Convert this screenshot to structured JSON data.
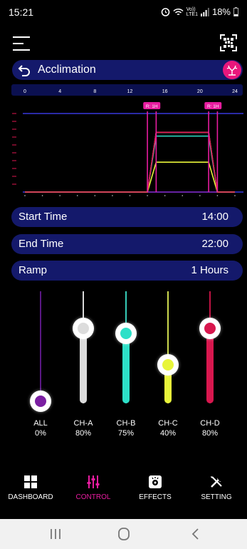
{
  "status": {
    "time": "15:21",
    "network_top": "Vo))",
    "network_bottom": "LTE1",
    "battery": "18%"
  },
  "header": {
    "title": "Acclimation"
  },
  "timeline": {
    "hours": [
      "0",
      "4",
      "8",
      "12",
      "16",
      "20",
      "24"
    ],
    "ramp_markers": [
      "R: 1H",
      "R: 1H"
    ]
  },
  "chart_data": {
    "type": "line",
    "xlim": [
      0,
      24
    ],
    "start_hour": 14,
    "end_hour": 22,
    "ramp_hours": 1,
    "series": [
      {
        "name": "ALL",
        "value": 0,
        "color": "#7b1fa2"
      },
      {
        "name": "CH-A",
        "value": 80,
        "color": "#e0e0e0"
      },
      {
        "name": "CH-B",
        "value": 75,
        "color": "#2de0c8"
      },
      {
        "name": "CH-C",
        "value": 40,
        "color": "#e8f53a"
      },
      {
        "name": "CH-D",
        "value": 80,
        "color": "#e0164f"
      }
    ]
  },
  "rows": [
    {
      "label": "Start Time",
      "value": "14:00"
    },
    {
      "label": "End Time",
      "value": "22:00"
    },
    {
      "label": "Ramp",
      "value": "1 Hours"
    }
  ],
  "channels": [
    {
      "name": "ALL",
      "percent": "0%",
      "level": 0,
      "color": "#7b1fa2",
      "track": "#6a1b9a"
    },
    {
      "name": "CH-A",
      "percent": "80%",
      "level": 80,
      "color": "#dcdcdc",
      "track": "#ffffff"
    },
    {
      "name": "CH-B",
      "percent": "75%",
      "level": 75,
      "color": "#2de0c8",
      "track": "#3ff0d8"
    },
    {
      "name": "CH-C",
      "percent": "40%",
      "level": 40,
      "color": "#e8f53a",
      "track": "#f0ff5c"
    },
    {
      "name": "CH-D",
      "percent": "80%",
      "level": 80,
      "color": "#d8174e",
      "track": "#e0164f"
    }
  ],
  "nav": [
    {
      "label": "DASHBOARD",
      "icon": "grid-icon",
      "active": false
    },
    {
      "label": "CONTROL",
      "icon": "sliders-icon",
      "active": true
    },
    {
      "label": "EFFECTS",
      "icon": "effects-icon",
      "active": false
    },
    {
      "label": "SETTING",
      "icon": "tools-icon",
      "active": false
    }
  ],
  "colors": {
    "accent": "#e8177c",
    "pill": "#14196b",
    "nav_active": "#e81ca0"
  }
}
